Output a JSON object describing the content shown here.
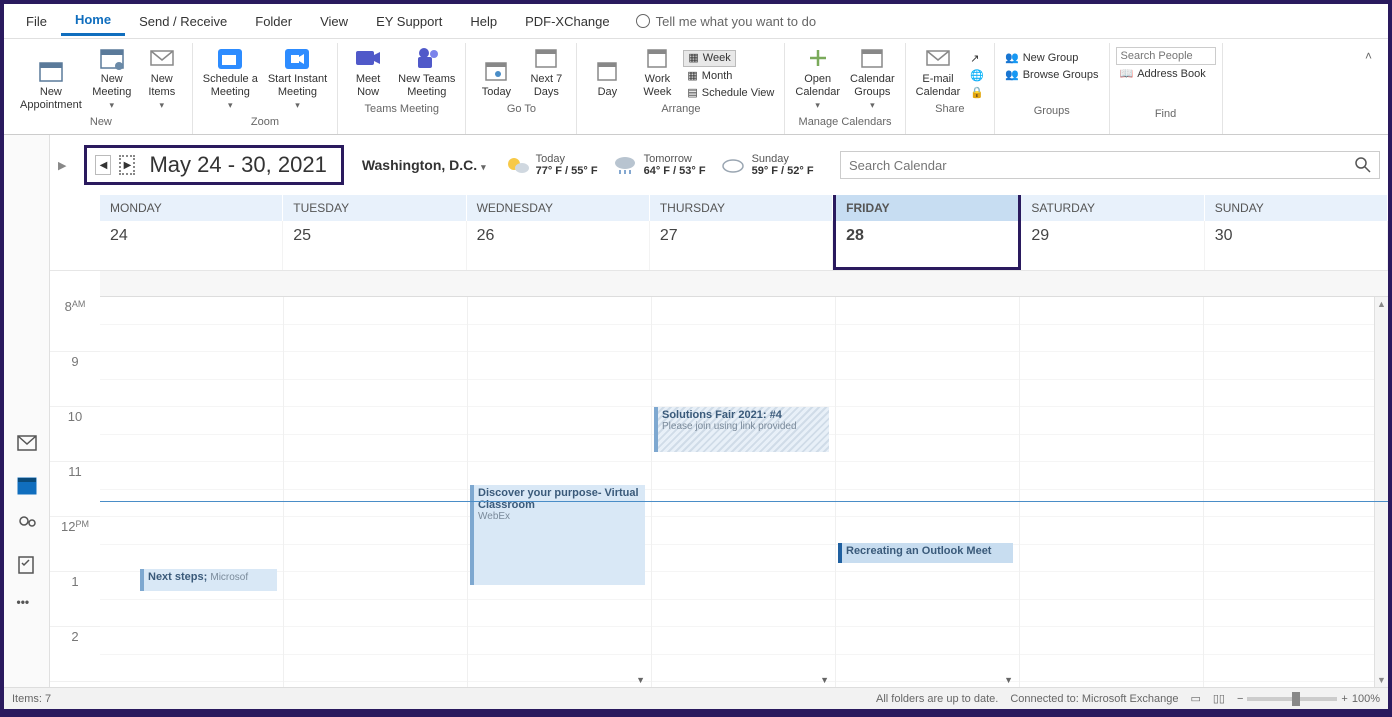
{
  "menu": {
    "items": [
      "File",
      "Home",
      "Send / Receive",
      "Folder",
      "View",
      "EY Support",
      "Help",
      "PDF-XChange"
    ],
    "active": "Home",
    "tell": "Tell me what you want to do"
  },
  "ribbon": {
    "new": {
      "label": "New",
      "appt": "New\nAppointment",
      "meeting": "New\nMeeting",
      "items": "New\nItems"
    },
    "zoom": {
      "label": "Zoom",
      "sched": "Schedule a\nMeeting",
      "instant": "Start Instant\nMeeting"
    },
    "teams": {
      "label": "Teams Meeting",
      "now": "Meet\nNow",
      "nt": "New Teams\nMeeting"
    },
    "goto": {
      "label": "Go To",
      "today": "Today",
      "next7": "Next 7\nDays"
    },
    "arrange": {
      "label": "Arrange",
      "day": "Day",
      "work": "Work\nWeek",
      "week": "Week",
      "month": "Month",
      "sched": "Schedule View"
    },
    "manage": {
      "label": "Manage Calendars",
      "open": "Open\nCalendar",
      "groups": "Calendar\nGroups"
    },
    "share": {
      "label": "Share",
      "email": "E-mail\nCalendar"
    },
    "groups": {
      "label": "Groups",
      "ng": "New Group",
      "bg": "Browse Groups"
    },
    "find": {
      "label": "Find",
      "search_placeholder": "Search People",
      "ab": "Address Book"
    }
  },
  "info": {
    "range": "May 24 - 30, 2021",
    "location": "Washington,  D.C.",
    "weather": [
      {
        "icon": "sun",
        "label": "Today",
        "temp": "77° F / 55° F"
      },
      {
        "icon": "rain",
        "label": "Tomorrow",
        "temp": "64° F / 53° F"
      },
      {
        "icon": "cloud",
        "label": "Sunday",
        "temp": "59° F / 52° F"
      }
    ],
    "search_placeholder": "Search Calendar"
  },
  "days": [
    {
      "name": "MONDAY",
      "num": "24",
      "today": false
    },
    {
      "name": "TUESDAY",
      "num": "25",
      "today": false
    },
    {
      "name": "WEDNESDAY",
      "num": "26",
      "today": false
    },
    {
      "name": "THURSDAY",
      "num": "27",
      "today": false
    },
    {
      "name": "FRIDAY",
      "num": "28",
      "today": true
    },
    {
      "name": "SATURDAY",
      "num": "29",
      "today": false
    },
    {
      "name": "SUNDAY",
      "num": "30",
      "today": false
    }
  ],
  "times": [
    {
      "h": "8",
      "ap": "AM"
    },
    {
      "h": "9",
      "ap": ""
    },
    {
      "h": "10",
      "ap": ""
    },
    {
      "h": "11",
      "ap": ""
    },
    {
      "h": "12",
      "ap": "PM"
    },
    {
      "h": "1",
      "ap": ""
    },
    {
      "h": "2",
      "ap": ""
    }
  ],
  "events": {
    "e1": {
      "title": "Solutions Fair 2021: #4",
      "sub": "Please join using link provided"
    },
    "e2": {
      "title": "Discover your purpose- Virtual Classroom",
      "sub": "WebEx"
    },
    "e3": {
      "title": "Recreating an Outlook Meet"
    },
    "e4": {
      "title": "Next steps;",
      "sub": "Microsof"
    }
  },
  "status": {
    "items": "Items: 7",
    "sync": "All folders are up to date.",
    "conn": "Connected to: Microsoft Exchange",
    "zoom": "100%"
  }
}
